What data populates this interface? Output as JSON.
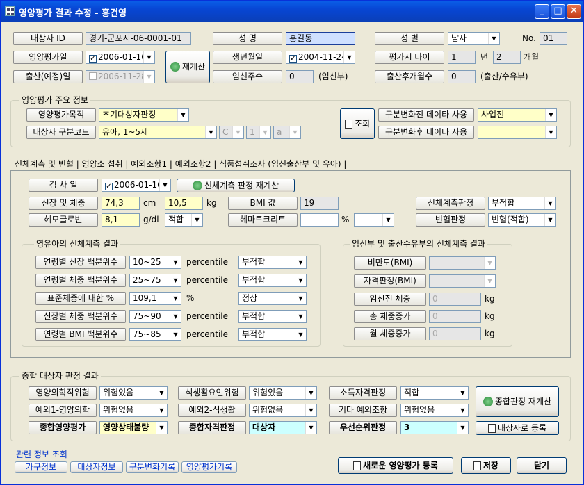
{
  "window": {
    "title": "영양평가 결과 수정 - 홍건영",
    "min": "_",
    "max": "□",
    "close": "✕"
  },
  "top": {
    "subject_id_label": "대상자 ID",
    "subject_id": "경기-군포시-06-0001-01",
    "name_label": "성 명",
    "name": "홍길동",
    "gender_label": "성 별",
    "gender": "남자",
    "no_label": "No.",
    "no": "01",
    "eval_date_label": "영양평가일",
    "eval_date": "2006-01-16",
    "birth_label": "생년월일",
    "birth": "2004-11-24",
    "eval_age_label": "평가시 나이",
    "age_year": "1",
    "year_unit": "년",
    "age_month": "2",
    "month_unit": "개월",
    "recalc_label": "재계산",
    "due_label": "출산(예정)일",
    "due": "2006-11-28",
    "preg_week_label": "임신주수",
    "preg_week": "0",
    "preg_week_unit": "(임신부)",
    "postpartum_label": "출산후개월수",
    "postpartum": "0",
    "postpartum_unit": "(출산/수유부)"
  },
  "main": {
    "title": "영양평가 주요 정보",
    "purpose_label": "영양평가목적",
    "purpose": "초기대상자판정",
    "code_label": "대상자 구분코드",
    "code": "유아, 1~5세",
    "code_c": "C",
    "code_1": "1",
    "code_a": "a",
    "lookup_label": "조회",
    "before_label": "구분변화전 데이타 사용",
    "before": "사업전",
    "after_label": "구분변화후 데이타 사용",
    "after": ""
  },
  "tabs": [
    "신체계측 및 빈혈",
    "영양소 섭취",
    "예외조항1",
    "예외조항2",
    "식품섭취조사 (임신출산부 및 유아)"
  ],
  "body": {
    "exam_date_label": "검 사 일",
    "exam_date": "2006-01-16",
    "rejudge_label": "신체계측 판정 재계산",
    "hw_label": "신장 및 체중",
    "height": "74,3",
    "cm": "cm",
    "weight": "10,5",
    "kg": "kg",
    "bmi_label": "BMI 값",
    "bmi": "19",
    "body_judge_label": "신체계측판정",
    "body_judge": "부적합",
    "hb_label": "헤모글로빈",
    "hb": "8,1",
    "gdl": "g/dl",
    "hb_judge": "적합",
    "hct_label": "헤마토크리트",
    "hct": "",
    "pct": "%",
    "hct_sel": "",
    "anemia_label": "빈혈판정",
    "anemia": "빈혈(적합)"
  },
  "infant": {
    "title": "영유아의 신체계측 결과",
    "rows": [
      {
        "label": "연령별 신장 백분위수",
        "value": "10~25",
        "unit": "percentile",
        "judge": "부적합"
      },
      {
        "label": "연령별 체중 백분위수",
        "value": "25~75",
        "unit": "percentile",
        "judge": "부적합"
      },
      {
        "label": "표준체중에 대한 %",
        "value": "109,1",
        "unit": "%",
        "judge": "정상"
      },
      {
        "label": "신장별 체중 백분위수",
        "value": "75~90",
        "unit": "percentile",
        "judge": "부적합"
      },
      {
        "label": "연령별 BMI 백분위수",
        "value": "75~85",
        "unit": "percentile",
        "judge": "부적합"
      }
    ]
  },
  "mother": {
    "title": "임신부 및 출산수유부의 신체계측 결과",
    "obesity_label": "비만도(BMI)",
    "qual_label": "자격판정(BMI)",
    "pre_weight_label": "임신전 체중",
    "pre_weight": "0",
    "total_gain_label": "총 체중증가",
    "total_gain": "0",
    "month_gain_label": "월 체중증가",
    "month_gain": "0",
    "kg": "kg"
  },
  "summary": {
    "title": "종합 대상자 판정 결과",
    "med_risk_label": "영양의학적위험",
    "med_risk": "위험있음",
    "diet_risk_label": "식생활요인위험",
    "diet_risk": "위험있음",
    "income_label": "소득자격판정",
    "income": "적합",
    "ex1_label": "예외1-영양의학",
    "ex1": "위험없음",
    "ex2_label": "예외2-식생활",
    "ex2": "위험없음",
    "other_label": "기타 예외조항",
    "other": "위험없음",
    "total_label": "종합영양평가",
    "total": "영양상태불량",
    "qual_label": "종합자격판정",
    "qual": "대상자",
    "priority_label": "우선순위판정",
    "priority": "3",
    "rejudge_label": "종합판정 재계산",
    "register_label": "대상자로 등록"
  },
  "footer": {
    "related_label": "관련 정보 조회",
    "links": [
      "가구정보",
      "대상자정보",
      "구분변화기록",
      "영양평가기록"
    ],
    "new_label": "새로운 영양평가 등록",
    "save_label": "저장",
    "close_label": "닫기"
  }
}
